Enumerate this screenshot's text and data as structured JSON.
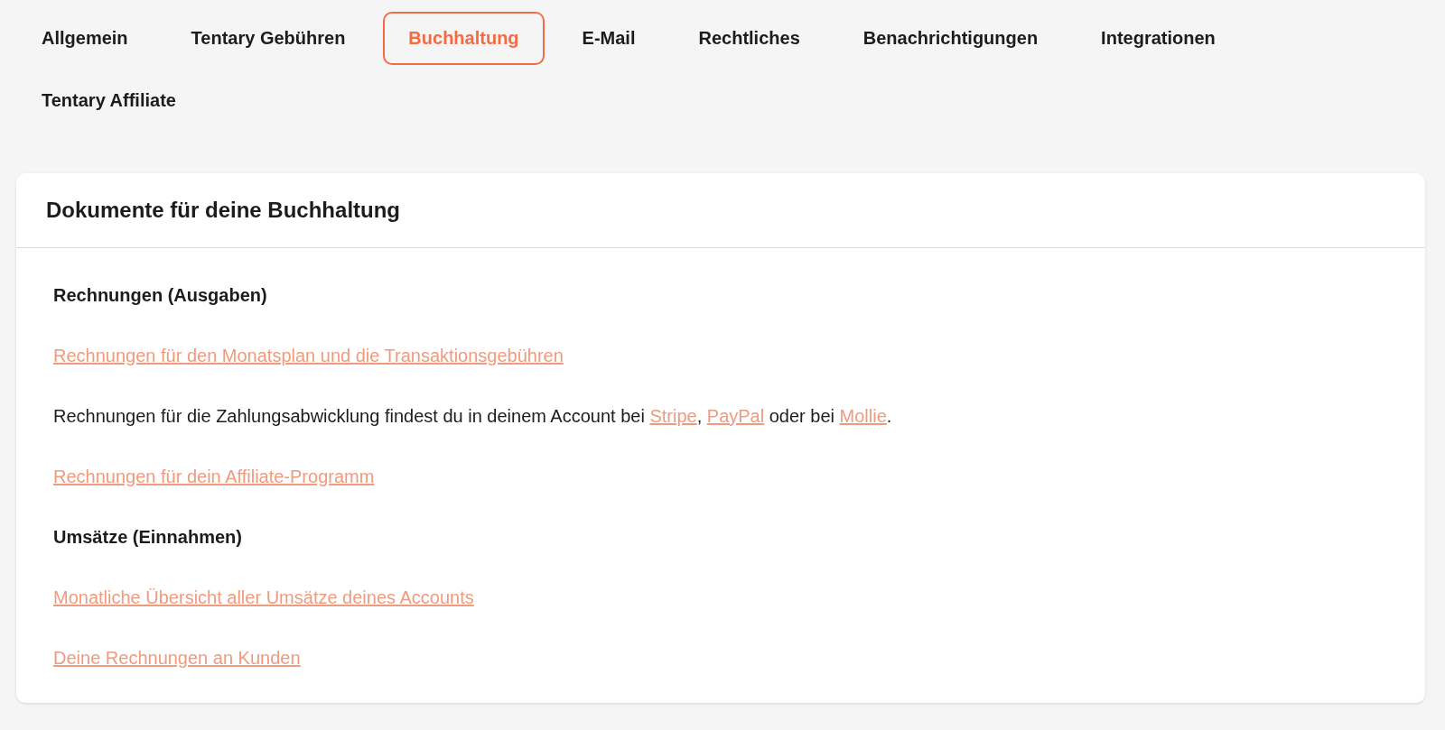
{
  "tabs": [
    {
      "label": "Allgemein",
      "selected": false
    },
    {
      "label": "Tentary Gebühren",
      "selected": false
    },
    {
      "label": "Buchhaltung",
      "selected": true
    },
    {
      "label": "E-Mail",
      "selected": false
    },
    {
      "label": "Rechtliches",
      "selected": false
    },
    {
      "label": "Benachrichtigungen",
      "selected": false
    },
    {
      "label": "Integrationen",
      "selected": false
    },
    {
      "label": "Tentary Affiliate",
      "selected": false
    }
  ],
  "card": {
    "title": "Dokumente für deine Buchhaltung",
    "blocks": [
      {
        "kind": "heading",
        "text": "Rechnungen (Ausgaben)"
      },
      {
        "kind": "link",
        "text": "Rechnungen für den Monatsplan und die Transaktionsgebühren"
      },
      {
        "kind": "paragraph",
        "parts": [
          {
            "kind": "text",
            "text": "Rechnungen für die Zahlungsabwicklung findest du in deinem Account bei "
          },
          {
            "kind": "link",
            "text": "Stripe"
          },
          {
            "kind": "text",
            "text": ", "
          },
          {
            "kind": "link",
            "text": "PayPal"
          },
          {
            "kind": "text",
            "text": " oder bei "
          },
          {
            "kind": "link",
            "text": "Mollie"
          },
          {
            "kind": "text",
            "text": "."
          }
        ]
      },
      {
        "kind": "link",
        "text": "Rechnungen für dein Affiliate-Programm"
      },
      {
        "kind": "heading",
        "text": "Umsätze (Einnahmen)"
      },
      {
        "kind": "link",
        "text": "Monatliche Übersicht aller Umsätze deines Accounts"
      },
      {
        "kind": "link",
        "text": "Deine Rechnungen an Kunden"
      }
    ]
  }
}
